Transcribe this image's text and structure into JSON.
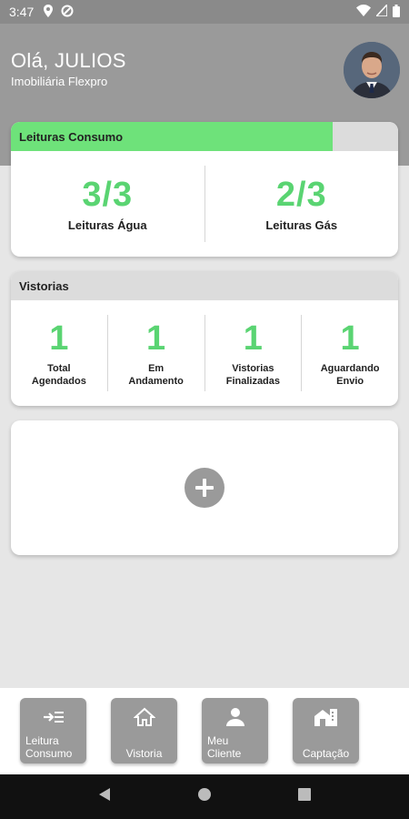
{
  "status_bar": {
    "time": "3:47"
  },
  "header": {
    "greeting": "Olá, JULIOS",
    "company": "Imobiliária Flexpro"
  },
  "consumo": {
    "title": "Leituras Consumo",
    "progress": 0.83,
    "agua": {
      "value": "3/3",
      "label": "Leituras Água"
    },
    "gas": {
      "value": "2/3",
      "label": "Leituras Gás"
    }
  },
  "vistorias": {
    "title": "Vistorias",
    "items": [
      {
        "value": "1",
        "line1": "Total",
        "line2": "Agendados"
      },
      {
        "value": "1",
        "line1": "Em",
        "line2": "Andamento"
      },
      {
        "value": "1",
        "line1": "Vistorias",
        "line2": "Finalizadas"
      },
      {
        "value": "1",
        "line1": "Aguardando",
        "line2": "Envio"
      }
    ]
  },
  "toolbar": {
    "items": [
      {
        "label1": "Leitura",
        "label2": "Consumo",
        "icon": "transfer-list-icon"
      },
      {
        "label1": "Vistoria",
        "label2": "",
        "icon": "home-icon"
      },
      {
        "label1": "Meu",
        "label2": "Cliente",
        "icon": "person-icon"
      },
      {
        "label1": "Captação",
        "label2": "",
        "icon": "building-icon"
      }
    ]
  },
  "colors": {
    "accent_green": "#5ad472",
    "progress_green": "#6ee27a",
    "header_gray": "#9a9a9a"
  }
}
